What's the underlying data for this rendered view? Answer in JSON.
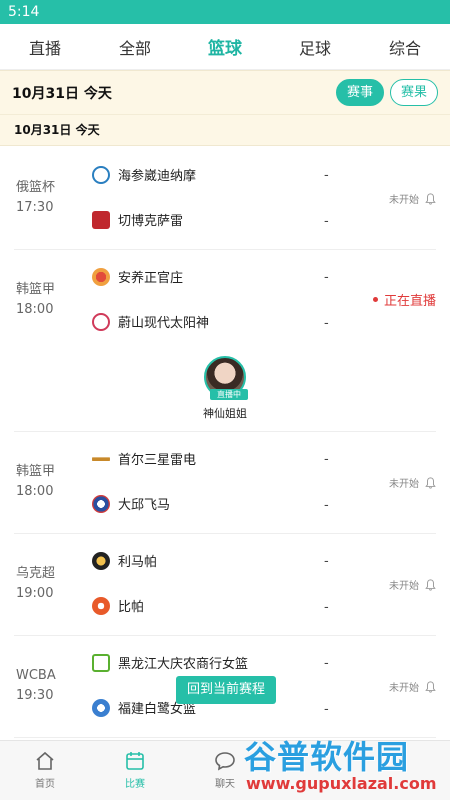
{
  "status_bar": {
    "time": "5:14"
  },
  "tabs": [
    {
      "label": "直播",
      "active": false
    },
    {
      "label": "全部",
      "active": false
    },
    {
      "label": "篮球",
      "active": true
    },
    {
      "label": "足球",
      "active": false
    },
    {
      "label": "综合",
      "active": false
    }
  ],
  "date_bar": {
    "date": "10月31日  今天",
    "events_label": "赛事",
    "results_label": "赛果"
  },
  "sub_date": "10月31日   今天",
  "matches": [
    {
      "league": "俄篮杯",
      "time": "17:30",
      "team1": "海参崴迪纳摩",
      "team2": "切博克萨雷",
      "score1": "-",
      "score2": "-",
      "status": "未开始"
    },
    {
      "league": "韩篮甲",
      "time": "18:00",
      "team1": "安养正官庄",
      "team2": "蔚山现代太阳神",
      "score1": "-",
      "score2": "-",
      "status": "正在直播",
      "anchor": {
        "name": "神仙姐姐",
        "badge": "直播中"
      }
    },
    {
      "league": "韩篮甲",
      "time": "18:00",
      "team1": "首尔三星雷电",
      "team2": "大邱飞马",
      "score1": "-",
      "score2": "-",
      "status": "未开始"
    },
    {
      "league": "乌克超",
      "time": "19:00",
      "team1": "利马帕",
      "team2": "比帕",
      "score1": "-",
      "score2": "-",
      "status": "未开始"
    },
    {
      "league": "WCBA",
      "time": "19:30",
      "team1": "黑龙江大庆农商行女篮",
      "team2": "福建白鹭女篮",
      "score1": "-",
      "score2": "-",
      "status": "未开始"
    }
  ],
  "float_button": "回到当前赛程",
  "bottom_nav": [
    {
      "label": "首页",
      "icon": "home-icon",
      "active": false
    },
    {
      "label": "比赛",
      "icon": "calendar-icon",
      "active": true
    },
    {
      "label": "聊天",
      "icon": "chat-icon",
      "active": false
    }
  ],
  "watermark": {
    "title": "谷普软件园",
    "url": "www.gupuxlazal.com"
  },
  "colors": {
    "accent": "#26bfa8",
    "live": "#e03a3a",
    "date_bg": "#fdf7e6"
  }
}
